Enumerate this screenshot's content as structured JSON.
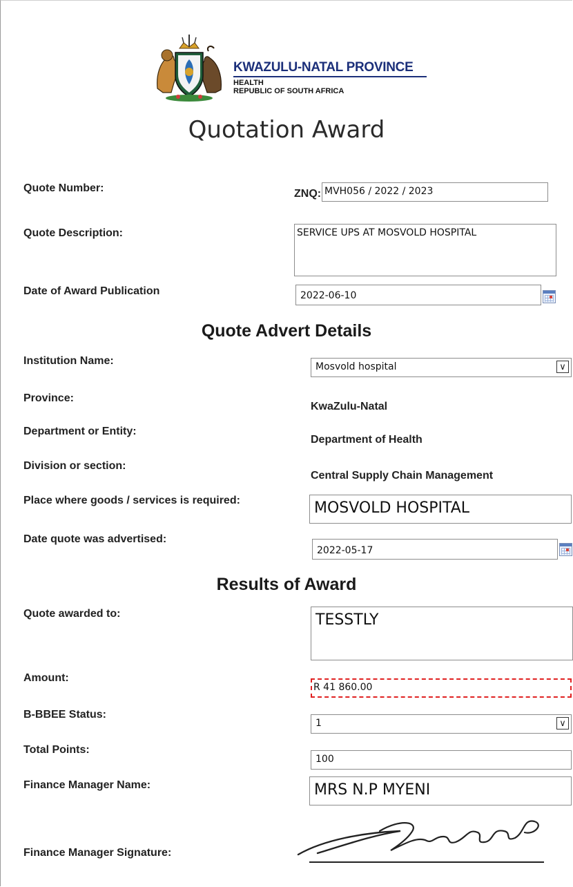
{
  "header": {
    "province": "KWAZULU-NATAL PROVINCE",
    "department": "HEALTH",
    "country": "REPUBLIC OF SOUTH AFRICA"
  },
  "title": "Quotation Award",
  "quote": {
    "number_label": "Quote Number:",
    "number_prefix": "ZNQ:",
    "number_value": "MVH056 / 2022 / 2023",
    "description_label": "Quote Description:",
    "description_value": "SERVICE UPS AT MOSVOLD HOSPITAL",
    "award_date_label": "Date of Award Publication",
    "award_date_value": "2022-06-10"
  },
  "advert": {
    "heading": "Quote Advert Details",
    "institution_label": "Institution Name:",
    "institution_value": "Mosvold hospital",
    "province_label": "Province:",
    "province_value": "KwaZulu-Natal",
    "department_label": "Department or Entity:",
    "department_value": "Department of Health",
    "division_label": "Division or section:",
    "division_value": "Central Supply Chain Management",
    "place_label": "Place where goods /  services is required:",
    "place_value": "MOSVOLD HOSPITAL",
    "advertised_label": "Date quote was advertised:",
    "advertised_value": "2022-05-17"
  },
  "results": {
    "heading": "Results of Award",
    "awarded_label": "Quote awarded to:",
    "awarded_value": "TESSTLY",
    "amount_label": "Amount:",
    "amount_value": "R 41 860.00",
    "bbbee_label": "B-BBEE Status:",
    "bbbee_value": "1",
    "points_label": "Total Points:",
    "points_value": "100",
    "manager_label": "Finance Manager Name:",
    "manager_value": "MRS N.P MYENI",
    "signature_label": "Finance Manager Signature:"
  },
  "icons": {
    "calendar": "calendar-icon",
    "dropdown": "chevron-down-icon"
  },
  "colors": {
    "brand_blue": "#1b2f7a",
    "amount_border": "#e02020"
  }
}
